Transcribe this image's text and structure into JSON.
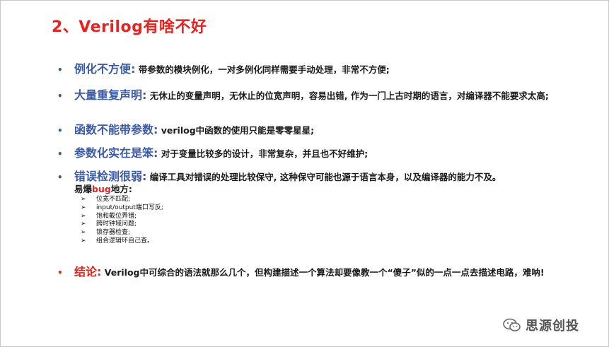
{
  "title": "2、Verilog有啥不好",
  "bullets": [
    {
      "head": "例化不方便:",
      "text": "带参数的模块例化，一对多例化同样需要手动处理，非常不方便;"
    },
    {
      "head": "大量重复声明:",
      "text": "无休止的变量声明，无休止的位宽声明，容易出错, 作为一门上古时期的语言，对编译器不能要求太高;"
    },
    {
      "head": "函数不能带参数:",
      "text": "verilog中函数的使用只能是零零星星;"
    },
    {
      "head": "参数化实在是笨:",
      "text": "对于变量比较多的设计，非常复杂，并且也不好维护;"
    },
    {
      "head": "错误检测很弱:",
      "text": "编译工具对错误的处理比较保守, 这种保守可能也源于语言本身，以及编译器的能力不及。"
    }
  ],
  "bug_line": {
    "prefix": "易爆",
    "highlight": "bug",
    "suffix": "地方:"
  },
  "bug_items": [
    "位宽不匹配;",
    "input/output端口写反;",
    "饱和截位弄错;",
    "跨时钟域问题;",
    "锁存器检查;",
    "组合逻辑环自己查。"
  ],
  "conclusion": {
    "head": "结论:",
    "text": "Verilog中可综合的语法就那么几个，但构建描述一个算法却要像教一个“傻子”似的一点一点去描述电路，难呐!"
  },
  "logo": {
    "text": "思源创投",
    "icon": "wechat-icon"
  },
  "colors": {
    "title": "#e8231f",
    "heading": "#3b5aa6",
    "highlight": "#e8231f"
  }
}
